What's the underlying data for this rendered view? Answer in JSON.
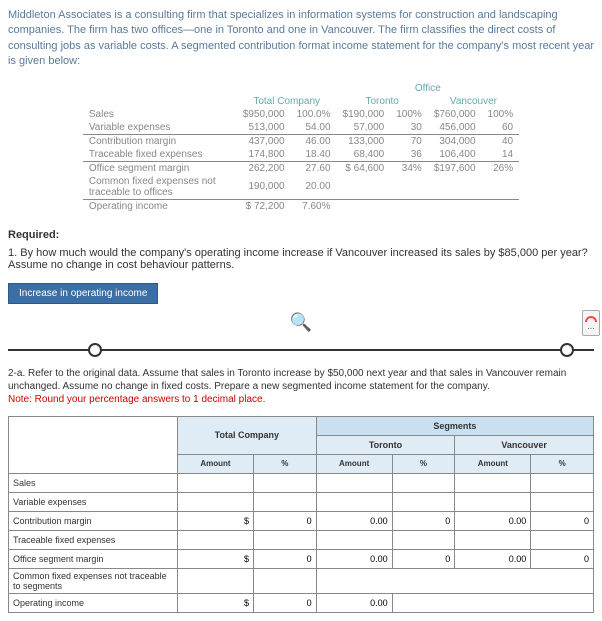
{
  "intro": "Middleton Associates is a consulting firm that specializes in information systems for construction and landscaping companies. The firm has two offices—one in Toronto and one in Vancouver. The firm classifies the direct costs of consulting jobs as variable costs. A segmented contribution format income statement for the company's most recent year is given below:",
  "income": {
    "office_hdr": "Office",
    "cols": [
      "Total Company",
      "Toronto",
      "Vancouver"
    ],
    "rows": [
      {
        "label": "Sales",
        "tc_v": "$950,000",
        "tc_p": "100.0%",
        "to_v": "$190,000",
        "to_p": "100%",
        "va_v": "$760,000",
        "va_p": "100%"
      },
      {
        "label": "Variable expenses",
        "tc_v": "513,000",
        "tc_p": "54.00",
        "to_v": "57,000",
        "to_p": "30",
        "va_v": "456,000",
        "va_p": "60"
      },
      {
        "label": "Contribution margin",
        "tc_v": "437,000",
        "tc_p": "46.00",
        "to_v": "133,000",
        "to_p": "70",
        "va_v": "304,000",
        "va_p": "40"
      },
      {
        "label": "Traceable fixed expenses",
        "tc_v": "174,800",
        "tc_p": "18.40",
        "to_v": "68,400",
        "to_p": "36",
        "va_v": "106,400",
        "va_p": "14"
      },
      {
        "label": "Office segment margin",
        "tc_v": "262,200",
        "tc_p": "27.60",
        "to_v": "$ 64,600",
        "to_p": "34%",
        "va_v": "$197,600",
        "va_p": "26%"
      },
      {
        "label": "Common fixed expenses not traceable to offices",
        "tc_v": "190,000",
        "tc_p": "20.00",
        "to_v": "",
        "to_p": "",
        "va_v": "",
        "va_p": ""
      },
      {
        "label": "Operating income",
        "tc_v": "$ 72,200",
        "tc_p": "7.60%",
        "to_v": "",
        "to_p": "",
        "va_v": "",
        "va_p": ""
      }
    ]
  },
  "required_hdr": "Required:",
  "q1": "1. By how much would the company's operating income increase if Vancouver increased its sales by $85,000 per year? Assume no change in cost behaviour patterns.",
  "tab_label": "Increase in operating income",
  "q2a": "2-a. Refer to the original data. Assume that sales in Toronto increase by $50,000 next year and that sales in Vancouver remain unchanged. Assume no change in fixed costs. Prepare a new segmented income statement for the company.",
  "note": "Note: Round your percentage answers to 1 decimal place.",
  "answer": {
    "seg_hdr": "Segments",
    "cols": [
      "Total Company",
      "Toronto",
      "Vancouver"
    ],
    "sub": [
      "Amount",
      "%"
    ],
    "rows": [
      "Sales",
      "Variable expenses",
      "Contribution margin",
      "Traceable fixed expenses",
      "Office segment margin",
      "Common fixed expenses not traceable to segments",
      "Operating income"
    ],
    "vals": {
      "r2": {
        "tcv": "$",
        "tcp": "0",
        "toa": "0.00",
        "top": "0",
        "vaa": "0.00",
        "vap": "0",
        "vapp": "0.00"
      },
      "r4": {
        "tcv": "$",
        "tcp": "0",
        "toa": "0.00",
        "top": "$",
        "topv": "0",
        "vaa": "0.00",
        "vap": "$",
        "vapv": "0",
        "vapp": "0.00"
      },
      "r6": {
        "arrow": "▾",
        "tcv": "$",
        "tcp": "0",
        "toa": "0.00"
      }
    }
  }
}
